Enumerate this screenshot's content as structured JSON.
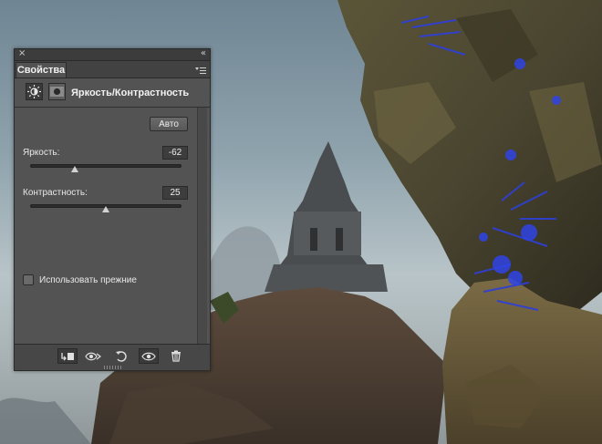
{
  "panel": {
    "close_glyph": "×",
    "collapse_glyph": "«",
    "tab_label": "Свойства",
    "adjustment_title": "Яркость/Контрастность",
    "auto_label": "Авто",
    "brightness": {
      "label": "Яркость:",
      "value": "-62",
      "min": -150,
      "max": 150
    },
    "contrast": {
      "label": "Контрастность:",
      "value": "25",
      "min": -50,
      "max": 100
    },
    "legacy_label": "Использовать прежние",
    "legacy_checked": false
  },
  "icons": {
    "close": "close-icon",
    "collapse": "collapse-icon",
    "menu": "panel-menu-icon",
    "adjustment": "brightness-contrast-icon",
    "mask": "layer-mask-icon",
    "clip": "clip-to-layer-icon",
    "view_previous": "view-previous-state-icon",
    "reset": "reset-icon",
    "visibility": "eye-icon",
    "delete": "trash-icon"
  },
  "colors": {
    "panel_bg": "#535353",
    "panel_dark": "#3c3c3c",
    "text": "#e8e8e8"
  }
}
